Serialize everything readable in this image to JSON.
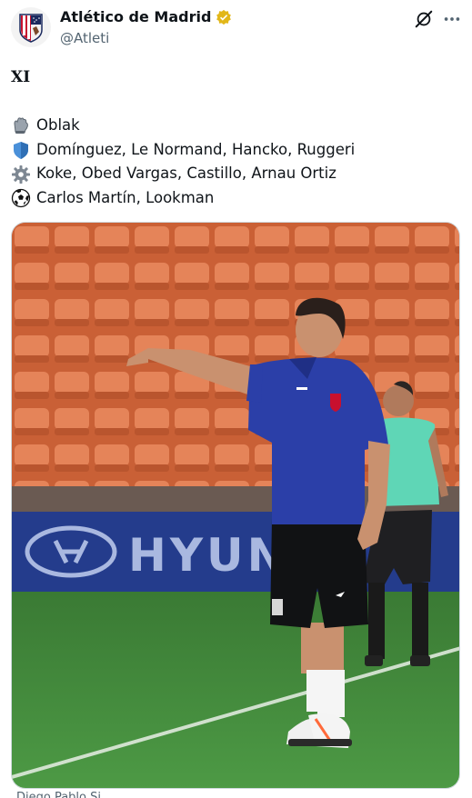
{
  "account": {
    "display_name": "Atlético de Madrid",
    "handle": "@Atleti",
    "verified": true,
    "verified_color": "#E2B719"
  },
  "post": {
    "title": "XI",
    "lines": [
      {
        "icon": "gloves-icon",
        "text": "Oblak"
      },
      {
        "icon": "shield-icon",
        "text": "Domínguez, Le Normand, Hancko, Ruggeri"
      },
      {
        "icon": "gear-icon",
        "text": "Koke, Obed Vargas, Castillo, Arnau Ortiz"
      },
      {
        "icon": "soccer-ball-icon",
        "text": "Carlos Martín, Lookman"
      }
    ]
  },
  "media": {
    "board_text": "HYUN",
    "board_color": "#1e3a8a",
    "seat_color": "#e07a4a",
    "pitch_color": "#3f8a3a"
  },
  "caption": {
    "text": "Diego Pablo Si..."
  },
  "actions": {
    "grok_icon": "grok-icon",
    "more_icon": "more-icon"
  }
}
